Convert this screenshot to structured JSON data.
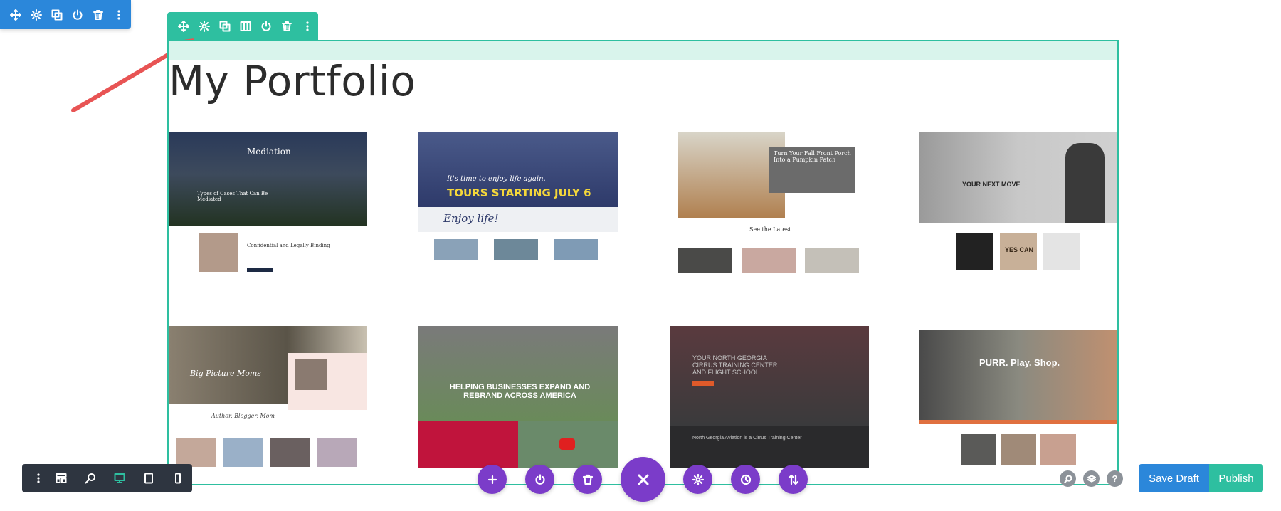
{
  "page": {
    "title": "My Portfolio"
  },
  "colors": {
    "section_blue": "#2b87da",
    "row_green": "#2ebfa0",
    "module_purple": "#7b3cc9",
    "annotation_red": "#e85454",
    "dark_toolbar": "#2e3540"
  },
  "section_toolbar": {
    "icons": [
      "move-icon",
      "gear-icon",
      "duplicate-icon",
      "power-icon",
      "trash-icon",
      "more-vertical-icon"
    ]
  },
  "row_toolbar": {
    "icons": [
      "move-icon",
      "gear-icon",
      "duplicate-icon",
      "columns-icon",
      "power-icon",
      "trash-icon",
      "more-vertical-icon"
    ]
  },
  "portfolio_items": [
    {
      "heading": "Mediation",
      "subheading": "Types of Cases That Can Be Mediated",
      "caption": "Confidential and Legally Binding"
    },
    {
      "heading": "It's time to enjoy life again.",
      "subheading": "TOURS STARTING JULY 6",
      "caption": "Enjoy life!"
    },
    {
      "heading": "Turn Your Fall Front Porch Into a Pumpkin Patch",
      "subheading": "See the Latest",
      "caption": ""
    },
    {
      "heading": "YOUR NEXT MOVE",
      "subheading": "",
      "caption": "YES CAN"
    },
    {
      "heading": "Big Picture Moms",
      "subheading": "Author, Blogger, Mom",
      "caption": "Author. Blogger. Mom."
    },
    {
      "heading": "HELPING BUSINESSES EXPAND AND REBRAND ACROSS AMERICA",
      "subheading": "",
      "caption": ""
    },
    {
      "heading": "YOUR NORTH GEORGIA CIRRUS TRAINING CENTER AND FLIGHT SCHOOL",
      "subheading": "North Georgia Aviation is a Cirrus Training Center",
      "caption": ""
    },
    {
      "heading": "PURR. Play. Shop.",
      "subheading": "",
      "caption": ""
    }
  ],
  "view_toolbar": {
    "icons": [
      "more-vertical-icon",
      "wireframe-icon",
      "zoom-icon",
      "desktop-icon",
      "tablet-icon",
      "phone-icon"
    ]
  },
  "page_actions": {
    "icons": [
      "add-icon",
      "power-icon",
      "trash-icon",
      "close-icon",
      "gear-icon",
      "history-icon",
      "sort-icon"
    ]
  },
  "help_icons": [
    "search-icon",
    "layers-icon",
    "help-icon"
  ],
  "help_label": "?",
  "buttons": {
    "save_draft": "Save Draft",
    "publish": "Publish"
  }
}
